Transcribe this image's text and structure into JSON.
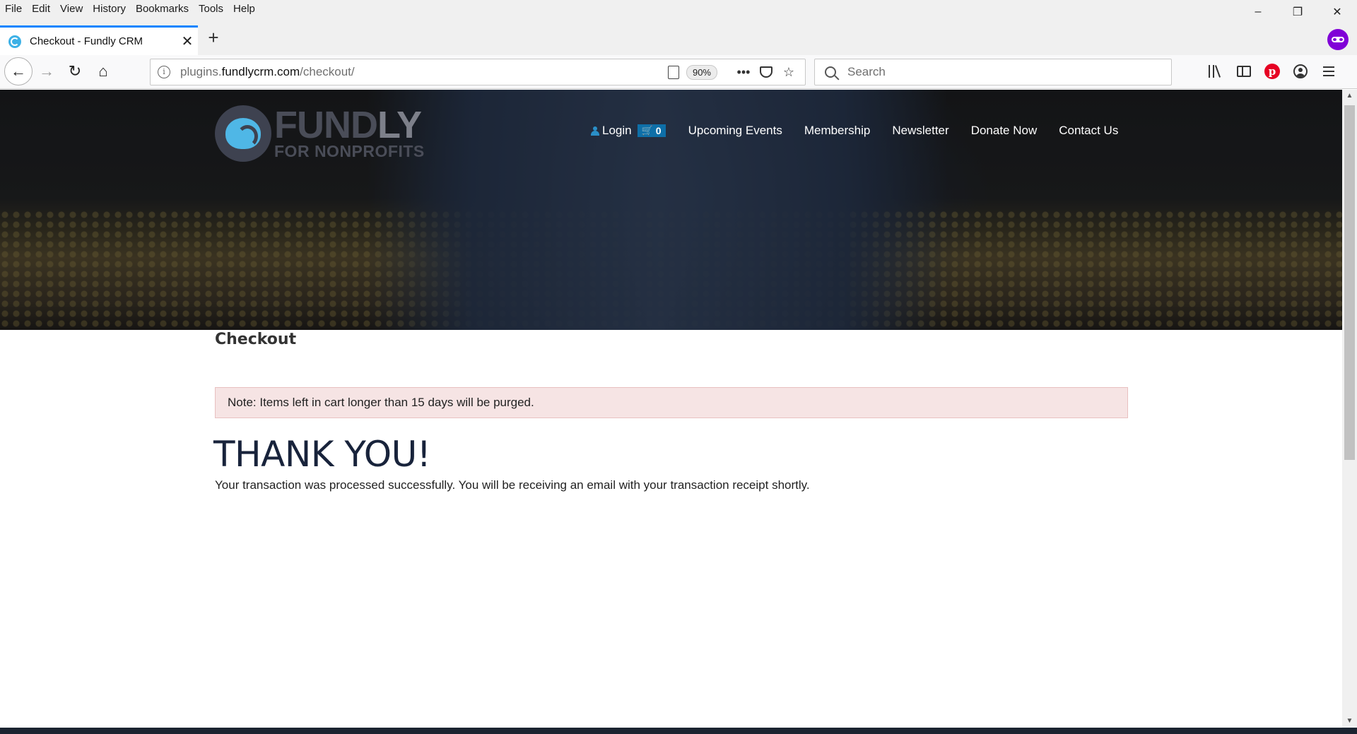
{
  "menubar": {
    "items": [
      "File",
      "Edit",
      "View",
      "History",
      "Bookmarks",
      "Tools",
      "Help"
    ]
  },
  "window": {
    "minimize_icon": "minimize-icon",
    "restore_icon": "restore-icon",
    "close_icon": "close-icon"
  },
  "tab": {
    "title": "Checkout - Fundly CRM",
    "close": "✕",
    "new_tab": "+"
  },
  "navbar": {
    "url_prefix": "plugins.",
    "url_host": "fundlycrm.com",
    "url_path": "/checkout/",
    "zoom": "90%",
    "more": "•••",
    "star": "☆",
    "search_placeholder": "Search"
  },
  "site": {
    "logo_name_a": "FUND",
    "logo_name_b": "LY",
    "logo_sub": "FOR NONPROFITS",
    "nav": {
      "login": "Login",
      "cart_count": "0",
      "items": [
        "Upcoming Events",
        "Membership",
        "Newsletter",
        "Donate Now",
        "Contact Us"
      ]
    }
  },
  "main": {
    "title": "Checkout",
    "notice": "Note: Items left in cart longer than 15 days will be purged.",
    "heading": "THANK YOU!",
    "message": "Your transaction was processed successfully. You will be receiving an email with your transaction receipt shortly."
  },
  "colors": {
    "accent": "#0a84ff",
    "brand_blue": "#4fb7e6",
    "notice_bg": "#f6e4e4",
    "heading": "#18233b",
    "cart_badge": "#0e6fa8"
  }
}
